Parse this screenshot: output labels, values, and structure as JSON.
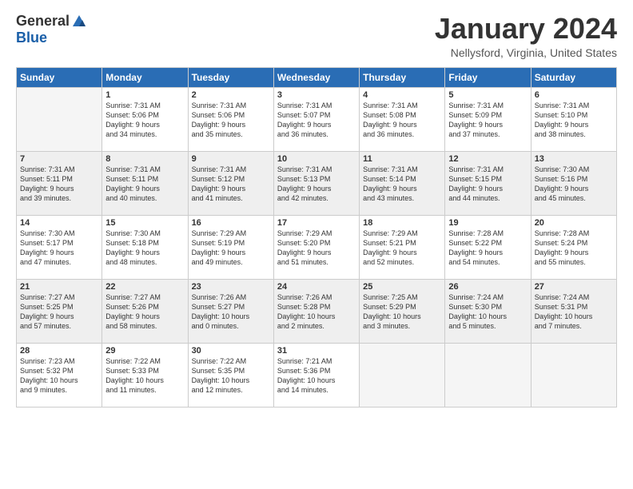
{
  "header": {
    "logo_general": "General",
    "logo_blue": "Blue",
    "month_title": "January 2024",
    "location": "Nellysford, Virginia, United States"
  },
  "weekdays": [
    "Sunday",
    "Monday",
    "Tuesday",
    "Wednesday",
    "Thursday",
    "Friday",
    "Saturday"
  ],
  "weeks": [
    [
      {
        "day": "",
        "text": ""
      },
      {
        "day": "1",
        "text": "Sunrise: 7:31 AM\nSunset: 5:06 PM\nDaylight: 9 hours\nand 34 minutes."
      },
      {
        "day": "2",
        "text": "Sunrise: 7:31 AM\nSunset: 5:06 PM\nDaylight: 9 hours\nand 35 minutes."
      },
      {
        "day": "3",
        "text": "Sunrise: 7:31 AM\nSunset: 5:07 PM\nDaylight: 9 hours\nand 36 minutes."
      },
      {
        "day": "4",
        "text": "Sunrise: 7:31 AM\nSunset: 5:08 PM\nDaylight: 9 hours\nand 36 minutes."
      },
      {
        "day": "5",
        "text": "Sunrise: 7:31 AM\nSunset: 5:09 PM\nDaylight: 9 hours\nand 37 minutes."
      },
      {
        "day": "6",
        "text": "Sunrise: 7:31 AM\nSunset: 5:10 PM\nDaylight: 9 hours\nand 38 minutes."
      }
    ],
    [
      {
        "day": "7",
        "text": "Sunrise: 7:31 AM\nSunset: 5:11 PM\nDaylight: 9 hours\nand 39 minutes."
      },
      {
        "day": "8",
        "text": "Sunrise: 7:31 AM\nSunset: 5:11 PM\nDaylight: 9 hours\nand 40 minutes."
      },
      {
        "day": "9",
        "text": "Sunrise: 7:31 AM\nSunset: 5:12 PM\nDaylight: 9 hours\nand 41 minutes."
      },
      {
        "day": "10",
        "text": "Sunrise: 7:31 AM\nSunset: 5:13 PM\nDaylight: 9 hours\nand 42 minutes."
      },
      {
        "day": "11",
        "text": "Sunrise: 7:31 AM\nSunset: 5:14 PM\nDaylight: 9 hours\nand 43 minutes."
      },
      {
        "day": "12",
        "text": "Sunrise: 7:31 AM\nSunset: 5:15 PM\nDaylight: 9 hours\nand 44 minutes."
      },
      {
        "day": "13",
        "text": "Sunrise: 7:30 AM\nSunset: 5:16 PM\nDaylight: 9 hours\nand 45 minutes."
      }
    ],
    [
      {
        "day": "14",
        "text": "Sunrise: 7:30 AM\nSunset: 5:17 PM\nDaylight: 9 hours\nand 47 minutes."
      },
      {
        "day": "15",
        "text": "Sunrise: 7:30 AM\nSunset: 5:18 PM\nDaylight: 9 hours\nand 48 minutes."
      },
      {
        "day": "16",
        "text": "Sunrise: 7:29 AM\nSunset: 5:19 PM\nDaylight: 9 hours\nand 49 minutes."
      },
      {
        "day": "17",
        "text": "Sunrise: 7:29 AM\nSunset: 5:20 PM\nDaylight: 9 hours\nand 51 minutes."
      },
      {
        "day": "18",
        "text": "Sunrise: 7:29 AM\nSunset: 5:21 PM\nDaylight: 9 hours\nand 52 minutes."
      },
      {
        "day": "19",
        "text": "Sunrise: 7:28 AM\nSunset: 5:22 PM\nDaylight: 9 hours\nand 54 minutes."
      },
      {
        "day": "20",
        "text": "Sunrise: 7:28 AM\nSunset: 5:24 PM\nDaylight: 9 hours\nand 55 minutes."
      }
    ],
    [
      {
        "day": "21",
        "text": "Sunrise: 7:27 AM\nSunset: 5:25 PM\nDaylight: 9 hours\nand 57 minutes."
      },
      {
        "day": "22",
        "text": "Sunrise: 7:27 AM\nSunset: 5:26 PM\nDaylight: 9 hours\nand 58 minutes."
      },
      {
        "day": "23",
        "text": "Sunrise: 7:26 AM\nSunset: 5:27 PM\nDaylight: 10 hours\nand 0 minutes."
      },
      {
        "day": "24",
        "text": "Sunrise: 7:26 AM\nSunset: 5:28 PM\nDaylight: 10 hours\nand 2 minutes."
      },
      {
        "day": "25",
        "text": "Sunrise: 7:25 AM\nSunset: 5:29 PM\nDaylight: 10 hours\nand 3 minutes."
      },
      {
        "day": "26",
        "text": "Sunrise: 7:24 AM\nSunset: 5:30 PM\nDaylight: 10 hours\nand 5 minutes."
      },
      {
        "day": "27",
        "text": "Sunrise: 7:24 AM\nSunset: 5:31 PM\nDaylight: 10 hours\nand 7 minutes."
      }
    ],
    [
      {
        "day": "28",
        "text": "Sunrise: 7:23 AM\nSunset: 5:32 PM\nDaylight: 10 hours\nand 9 minutes."
      },
      {
        "day": "29",
        "text": "Sunrise: 7:22 AM\nSunset: 5:33 PM\nDaylight: 10 hours\nand 11 minutes."
      },
      {
        "day": "30",
        "text": "Sunrise: 7:22 AM\nSunset: 5:35 PM\nDaylight: 10 hours\nand 12 minutes."
      },
      {
        "day": "31",
        "text": "Sunrise: 7:21 AM\nSunset: 5:36 PM\nDaylight: 10 hours\nand 14 minutes."
      },
      {
        "day": "",
        "text": ""
      },
      {
        "day": "",
        "text": ""
      },
      {
        "day": "",
        "text": ""
      }
    ]
  ]
}
